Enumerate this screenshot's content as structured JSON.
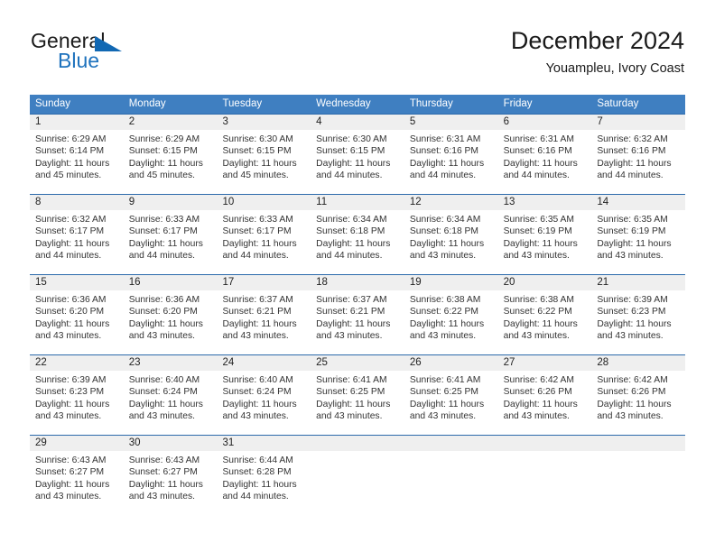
{
  "brand": {
    "name_top": "General",
    "name_bottom": "Blue",
    "accent_color": "#1168b3",
    "triangle_icon": "triangle-icon"
  },
  "header": {
    "title": "December 2024",
    "subtitle": "Youampleu, Ivory Coast"
  },
  "calendar": {
    "header_bg": "#3f7fc1",
    "row_border_color": "#2c6aab",
    "day_number_bg": "#efefef",
    "weekdays": [
      "Sunday",
      "Monday",
      "Tuesday",
      "Wednesday",
      "Thursday",
      "Friday",
      "Saturday"
    ],
    "weeks": [
      [
        {
          "day": "1",
          "sunrise": "Sunrise: 6:29 AM",
          "sunset": "Sunset: 6:14 PM",
          "daylight_1": "Daylight: 11 hours",
          "daylight_2": "and 45 minutes."
        },
        {
          "day": "2",
          "sunrise": "Sunrise: 6:29 AM",
          "sunset": "Sunset: 6:15 PM",
          "daylight_1": "Daylight: 11 hours",
          "daylight_2": "and 45 minutes."
        },
        {
          "day": "3",
          "sunrise": "Sunrise: 6:30 AM",
          "sunset": "Sunset: 6:15 PM",
          "daylight_1": "Daylight: 11 hours",
          "daylight_2": "and 45 minutes."
        },
        {
          "day": "4",
          "sunrise": "Sunrise: 6:30 AM",
          "sunset": "Sunset: 6:15 PM",
          "daylight_1": "Daylight: 11 hours",
          "daylight_2": "and 44 minutes."
        },
        {
          "day": "5",
          "sunrise": "Sunrise: 6:31 AM",
          "sunset": "Sunset: 6:16 PM",
          "daylight_1": "Daylight: 11 hours",
          "daylight_2": "and 44 minutes."
        },
        {
          "day": "6",
          "sunrise": "Sunrise: 6:31 AM",
          "sunset": "Sunset: 6:16 PM",
          "daylight_1": "Daylight: 11 hours",
          "daylight_2": "and 44 minutes."
        },
        {
          "day": "7",
          "sunrise": "Sunrise: 6:32 AM",
          "sunset": "Sunset: 6:16 PM",
          "daylight_1": "Daylight: 11 hours",
          "daylight_2": "and 44 minutes."
        }
      ],
      [
        {
          "day": "8",
          "sunrise": "Sunrise: 6:32 AM",
          "sunset": "Sunset: 6:17 PM",
          "daylight_1": "Daylight: 11 hours",
          "daylight_2": "and 44 minutes."
        },
        {
          "day": "9",
          "sunrise": "Sunrise: 6:33 AM",
          "sunset": "Sunset: 6:17 PM",
          "daylight_1": "Daylight: 11 hours",
          "daylight_2": "and 44 minutes."
        },
        {
          "day": "10",
          "sunrise": "Sunrise: 6:33 AM",
          "sunset": "Sunset: 6:17 PM",
          "daylight_1": "Daylight: 11 hours",
          "daylight_2": "and 44 minutes."
        },
        {
          "day": "11",
          "sunrise": "Sunrise: 6:34 AM",
          "sunset": "Sunset: 6:18 PM",
          "daylight_1": "Daylight: 11 hours",
          "daylight_2": "and 44 minutes."
        },
        {
          "day": "12",
          "sunrise": "Sunrise: 6:34 AM",
          "sunset": "Sunset: 6:18 PM",
          "daylight_1": "Daylight: 11 hours",
          "daylight_2": "and 43 minutes."
        },
        {
          "day": "13",
          "sunrise": "Sunrise: 6:35 AM",
          "sunset": "Sunset: 6:19 PM",
          "daylight_1": "Daylight: 11 hours",
          "daylight_2": "and 43 minutes."
        },
        {
          "day": "14",
          "sunrise": "Sunrise: 6:35 AM",
          "sunset": "Sunset: 6:19 PM",
          "daylight_1": "Daylight: 11 hours",
          "daylight_2": "and 43 minutes."
        }
      ],
      [
        {
          "day": "15",
          "sunrise": "Sunrise: 6:36 AM",
          "sunset": "Sunset: 6:20 PM",
          "daylight_1": "Daylight: 11 hours",
          "daylight_2": "and 43 minutes."
        },
        {
          "day": "16",
          "sunrise": "Sunrise: 6:36 AM",
          "sunset": "Sunset: 6:20 PM",
          "daylight_1": "Daylight: 11 hours",
          "daylight_2": "and 43 minutes."
        },
        {
          "day": "17",
          "sunrise": "Sunrise: 6:37 AM",
          "sunset": "Sunset: 6:21 PM",
          "daylight_1": "Daylight: 11 hours",
          "daylight_2": "and 43 minutes."
        },
        {
          "day": "18",
          "sunrise": "Sunrise: 6:37 AM",
          "sunset": "Sunset: 6:21 PM",
          "daylight_1": "Daylight: 11 hours",
          "daylight_2": "and 43 minutes."
        },
        {
          "day": "19",
          "sunrise": "Sunrise: 6:38 AM",
          "sunset": "Sunset: 6:22 PM",
          "daylight_1": "Daylight: 11 hours",
          "daylight_2": "and 43 minutes."
        },
        {
          "day": "20",
          "sunrise": "Sunrise: 6:38 AM",
          "sunset": "Sunset: 6:22 PM",
          "daylight_1": "Daylight: 11 hours",
          "daylight_2": "and 43 minutes."
        },
        {
          "day": "21",
          "sunrise": "Sunrise: 6:39 AM",
          "sunset": "Sunset: 6:23 PM",
          "daylight_1": "Daylight: 11 hours",
          "daylight_2": "and 43 minutes."
        }
      ],
      [
        {
          "day": "22",
          "sunrise": "Sunrise: 6:39 AM",
          "sunset": "Sunset: 6:23 PM",
          "daylight_1": "Daylight: 11 hours",
          "daylight_2": "and 43 minutes."
        },
        {
          "day": "23",
          "sunrise": "Sunrise: 6:40 AM",
          "sunset": "Sunset: 6:24 PM",
          "daylight_1": "Daylight: 11 hours",
          "daylight_2": "and 43 minutes."
        },
        {
          "day": "24",
          "sunrise": "Sunrise: 6:40 AM",
          "sunset": "Sunset: 6:24 PM",
          "daylight_1": "Daylight: 11 hours",
          "daylight_2": "and 43 minutes."
        },
        {
          "day": "25",
          "sunrise": "Sunrise: 6:41 AM",
          "sunset": "Sunset: 6:25 PM",
          "daylight_1": "Daylight: 11 hours",
          "daylight_2": "and 43 minutes."
        },
        {
          "day": "26",
          "sunrise": "Sunrise: 6:41 AM",
          "sunset": "Sunset: 6:25 PM",
          "daylight_1": "Daylight: 11 hours",
          "daylight_2": "and 43 minutes."
        },
        {
          "day": "27",
          "sunrise": "Sunrise: 6:42 AM",
          "sunset": "Sunset: 6:26 PM",
          "daylight_1": "Daylight: 11 hours",
          "daylight_2": "and 43 minutes."
        },
        {
          "day": "28",
          "sunrise": "Sunrise: 6:42 AM",
          "sunset": "Sunset: 6:26 PM",
          "daylight_1": "Daylight: 11 hours",
          "daylight_2": "and 43 minutes."
        }
      ],
      [
        {
          "day": "29",
          "sunrise": "Sunrise: 6:43 AM",
          "sunset": "Sunset: 6:27 PM",
          "daylight_1": "Daylight: 11 hours",
          "daylight_2": "and 43 minutes."
        },
        {
          "day": "30",
          "sunrise": "Sunrise: 6:43 AM",
          "sunset": "Sunset: 6:27 PM",
          "daylight_1": "Daylight: 11 hours",
          "daylight_2": "and 43 minutes."
        },
        {
          "day": "31",
          "sunrise": "Sunrise: 6:44 AM",
          "sunset": "Sunset: 6:28 PM",
          "daylight_1": "Daylight: 11 hours",
          "daylight_2": "and 44 minutes."
        },
        {
          "day": "",
          "sunrise": "",
          "sunset": "",
          "daylight_1": "",
          "daylight_2": ""
        },
        {
          "day": "",
          "sunrise": "",
          "sunset": "",
          "daylight_1": "",
          "daylight_2": ""
        },
        {
          "day": "",
          "sunrise": "",
          "sunset": "",
          "daylight_1": "",
          "daylight_2": ""
        },
        {
          "day": "",
          "sunrise": "",
          "sunset": "",
          "daylight_1": "",
          "daylight_2": ""
        }
      ]
    ]
  }
}
